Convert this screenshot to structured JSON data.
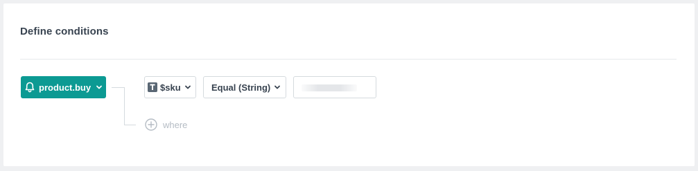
{
  "section": {
    "title": "Define conditions"
  },
  "event": {
    "label": "product.buy",
    "icon": "bell-icon",
    "color": "#0c9a93"
  },
  "condition": {
    "parameter": {
      "type_icon": "text-type-icon",
      "label": "$sku"
    },
    "operator": {
      "label": "Equal (String)"
    },
    "value": {
      "current": "",
      "placeholder": ""
    }
  },
  "add_where": {
    "label": "where",
    "icon": "plus-circle-icon"
  }
}
